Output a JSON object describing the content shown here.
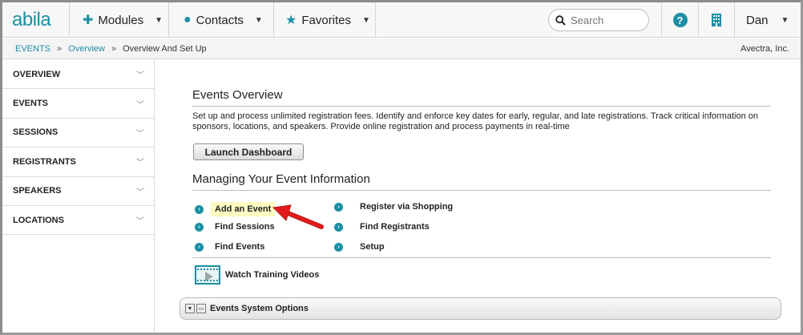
{
  "header": {
    "logo": "abila",
    "modules_label": "Modules",
    "contacts_label": "Contacts",
    "favorites_label": "Favorites",
    "search_placeholder": "Search",
    "user_label": "Dan"
  },
  "breadcrumb": {
    "items": [
      "EVENTS",
      "Overview",
      "Overview And Set Up"
    ],
    "separator": "»",
    "company": "Avectra, Inc."
  },
  "sidebar": {
    "items": [
      {
        "label": "OVERVIEW"
      },
      {
        "label": "EVENTS"
      },
      {
        "label": "SESSIONS"
      },
      {
        "label": "REGISTRANTS"
      },
      {
        "label": "SPEAKERS"
      },
      {
        "label": "LOCATIONS"
      }
    ]
  },
  "main": {
    "overview_title": "Events Overview",
    "overview_desc": "Set up and process unlimited registration fees. Identify and enforce key dates for early, regular, and late registrations. Track critical information on sponsors, locations, and speakers. Provide online registration and process payments in real-time",
    "launch_label": "Launch Dashboard",
    "managing_title": "Managing Your Event Information",
    "links_left": [
      "Add an Event",
      "Find Sessions",
      "Find Events"
    ],
    "links_right": [
      "Register via Shopping",
      "Find Registrants",
      "Setup"
    ],
    "video_label": "Watch Training Videos",
    "options_label": "Events System Options"
  },
  "colors": {
    "accent": "#1d8fa3",
    "highlight": "#fdfbc2",
    "arrow": "#e31b1b"
  }
}
